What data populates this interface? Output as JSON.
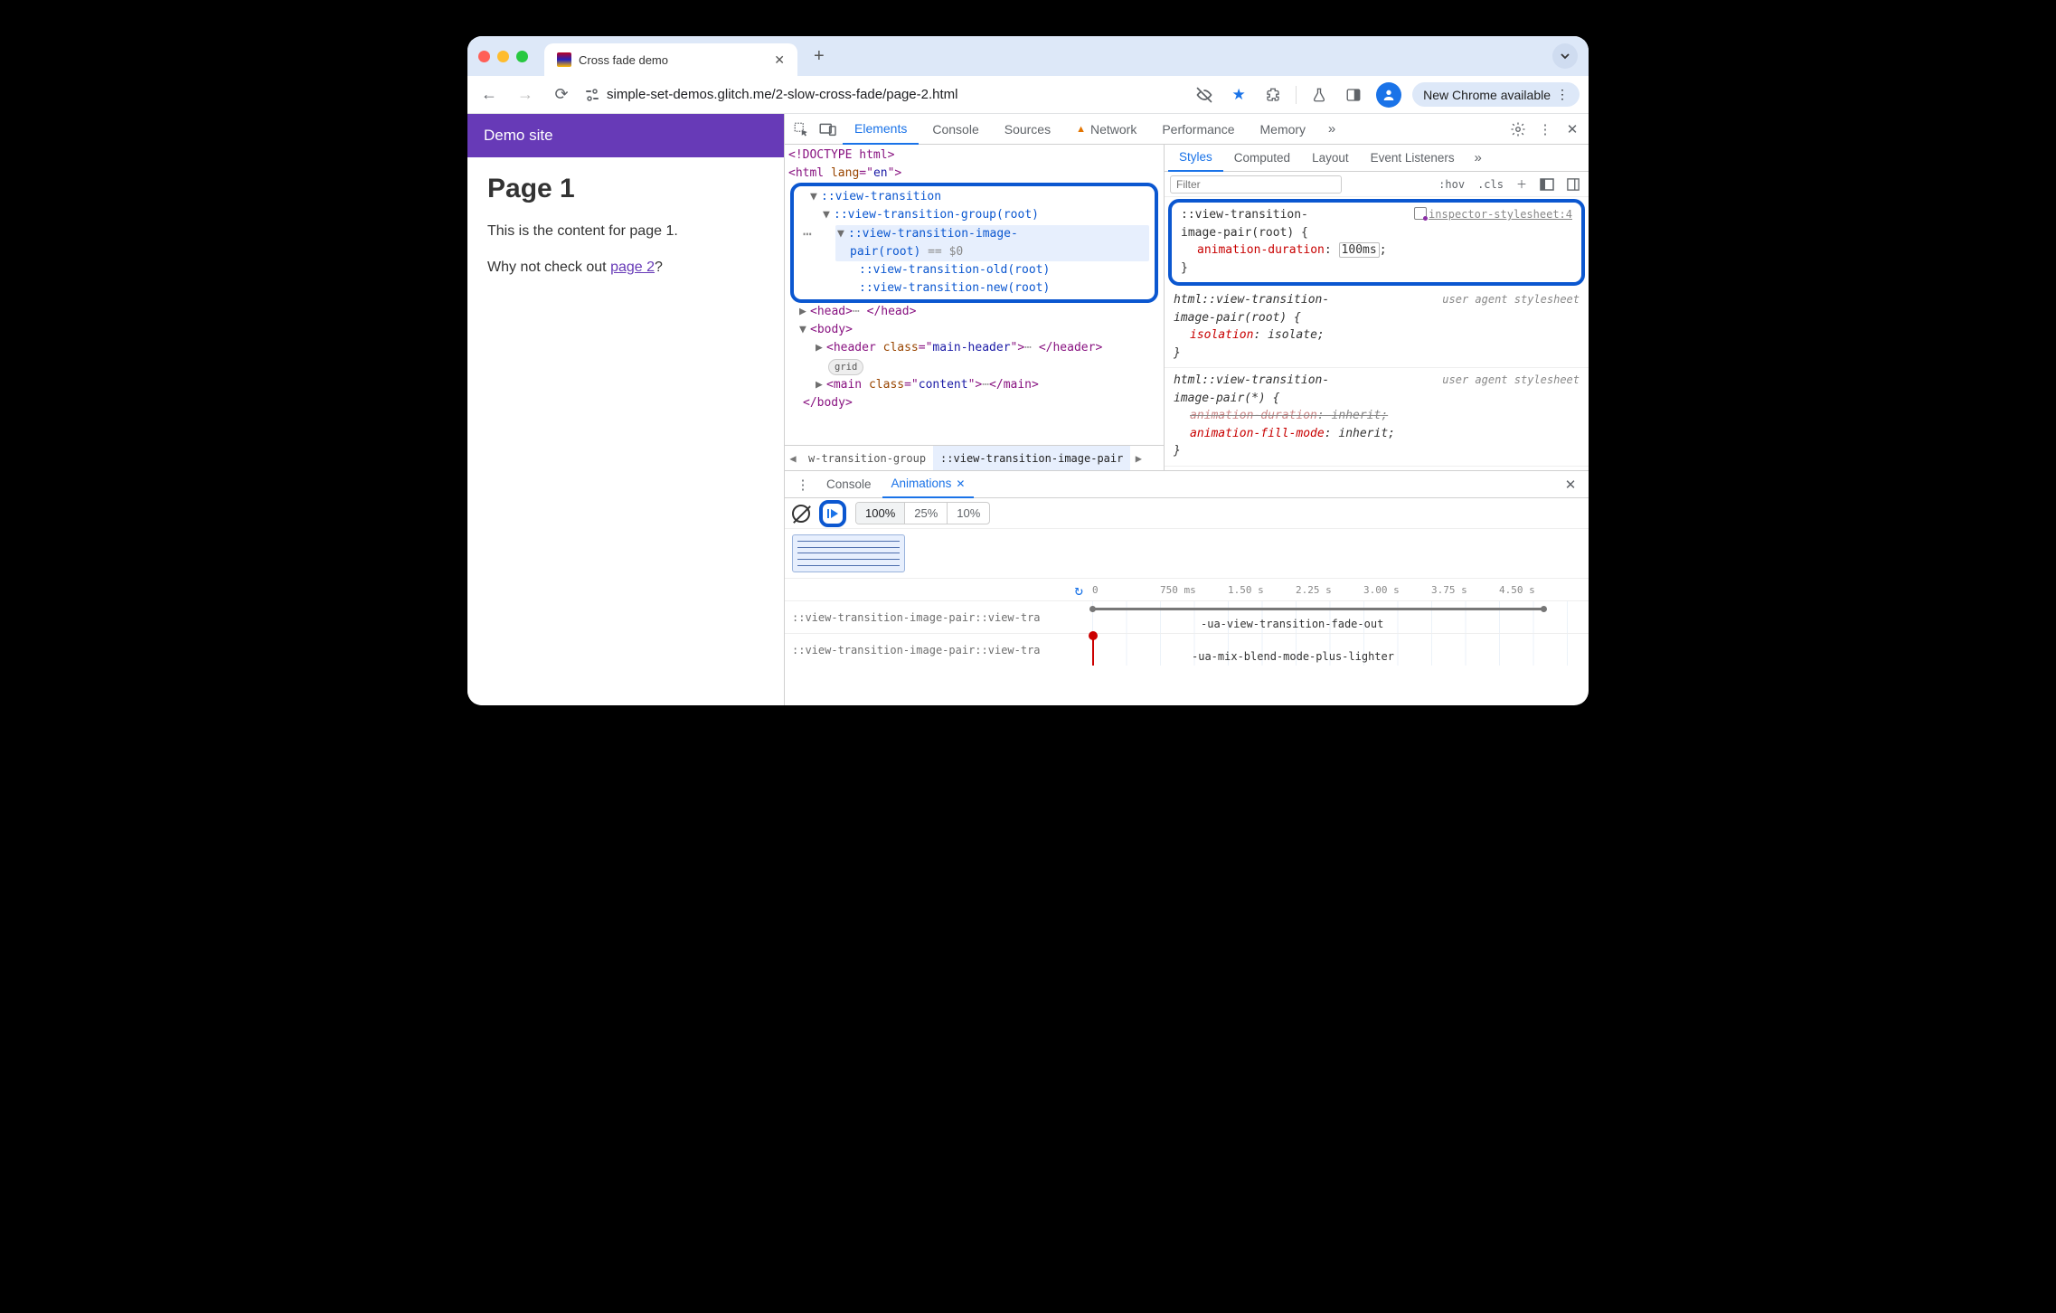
{
  "browser": {
    "tab_title": "Cross fade demo",
    "url": "simple-set-demos.glitch.me/2-slow-cross-fade/page-2.html",
    "update_chip": "New Chrome available"
  },
  "page": {
    "site_header": "Demo site",
    "h1": "Page 1",
    "p1": "This is the content for page 1.",
    "p2_pre": "Why not check out ",
    "p2_link": "page 2",
    "p2_post": "?"
  },
  "devtools": {
    "tabs": [
      "Elements",
      "Console",
      "Sources",
      "Network",
      "Performance",
      "Memory"
    ],
    "tree": {
      "doctype": "<!DOCTYPE html>",
      "html_open": "<html lang=\"en\">",
      "vt": "::view-transition",
      "vt_group": "::view-transition-group(root)",
      "vt_pair_1": "::view-transition-image-",
      "vt_pair_2": "pair(root)",
      "eq": " == $0",
      "vt_old": "::view-transition-old(root)",
      "vt_new": "::view-transition-new(root)",
      "head": "<head>… </head>",
      "body_open": "<body>",
      "header_open": "<header class=\"main-header\">",
      "header_ell": "…",
      "header_close": " </header>",
      "grid_pill": "grid",
      "main_open": "<main class=\"content\">",
      "main_ell": "…",
      "main_close": "</main>",
      "body_close": "</body>"
    },
    "crumbs": {
      "a": "w-transition-group",
      "b": "::view-transition-image-pair"
    },
    "styles": {
      "tabs": [
        "Styles",
        "Computed",
        "Layout",
        "Event Listeners"
      ],
      "filter_ph": "Filter",
      "hov": ":hov",
      "cls": ".cls",
      "rule1": {
        "sel": "::view-transition-image-pair(root) {",
        "src": "inspector-stylesheet:4",
        "prop": "animation-duration",
        "val": "100ms"
      },
      "rule2": {
        "sel": "html::view-transition-image-pair(root) {",
        "src": "user agent stylesheet",
        "prop": "isolation",
        "val": "isolate"
      },
      "rule3": {
        "sel": "html::view-transition-image-pair(*) {",
        "src": "user agent stylesheet",
        "p1": "animation-duration",
        "v1": "inherit",
        "p2": "animation-fill-mode",
        "v2": "inherit"
      }
    },
    "drawer": {
      "tabs": [
        "Console",
        "Animations"
      ],
      "speeds": [
        "100%",
        "25%",
        "10%"
      ],
      "ticks": [
        "0",
        "750 ms",
        "1.50 s",
        "2.25 s",
        "3.00 s",
        "3.75 s",
        "4.50 s"
      ],
      "row1": {
        "label": "::view-transition-image-pair::view-tra",
        "name": "-ua-view-transition-fade-out"
      },
      "row2": {
        "label": "::view-transition-image-pair::view-tra",
        "name": "-ua-mix-blend-mode-plus-lighter"
      }
    }
  }
}
